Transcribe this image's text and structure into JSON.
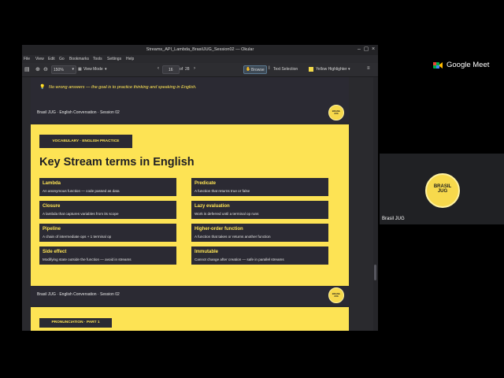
{
  "window": {
    "title": "Streams_API_Lambda_BrasilJUG_Session02 — Okular"
  },
  "menu": [
    "File",
    "View",
    "Edit",
    "Go",
    "Bookmarks",
    "Tools",
    "Settings",
    "Help"
  ],
  "toolbar": {
    "zoom": "150%",
    "view_mode": "View Mode",
    "page_current": "16",
    "page_of": "of",
    "page_total": "28",
    "browse": "Browse",
    "text_selection": "Text Selection",
    "highlighter": "Yellow Highlighter"
  },
  "slide_prev": {
    "note": "No wrong answers — the goal is to practice thinking and speaking in English.",
    "footer": "Brasil JUG · English Conversation · Session 02"
  },
  "slide": {
    "tag": "VOCABULARY · ENGLISH PRACTICE",
    "title": "Key Stream terms in English",
    "cards": [
      {
        "term": "Lambda",
        "desc": "An anonymous function — code passed as data"
      },
      {
        "term": "Predicate",
        "desc": "A function that returns true or false"
      },
      {
        "term": "Closure",
        "desc": "A lambda that captures variables from its scope"
      },
      {
        "term": "Lazy evaluation",
        "desc": "Work is deferred until a terminal op runs"
      },
      {
        "term": "Pipeline",
        "desc": "A chain of intermediate ops + 1 terminal op"
      },
      {
        "term": "Higher-order function",
        "desc": "A function that takes or returns another function"
      },
      {
        "term": "Side effect",
        "desc": "Modifying state outside the function — avoid in streams"
      },
      {
        "term": "Immutable",
        "desc": "Cannot change after creation — safe in parallel streams"
      }
    ],
    "footer": "Brasil JUG · English Conversation · Session 02"
  },
  "slide_next": {
    "tag": "PRONUNCIATION · PART 1"
  },
  "logo": {
    "line1": "BRASIL",
    "line2": "JUG"
  },
  "meet": {
    "brand": "Google Meet",
    "participant_logo_line1": "BRASIL",
    "participant_logo_line2": "JUG",
    "participant_name": "Brasil JUG"
  },
  "colors": {
    "accent_yellow": "#fde354",
    "slide_dark": "#2b2a33"
  }
}
